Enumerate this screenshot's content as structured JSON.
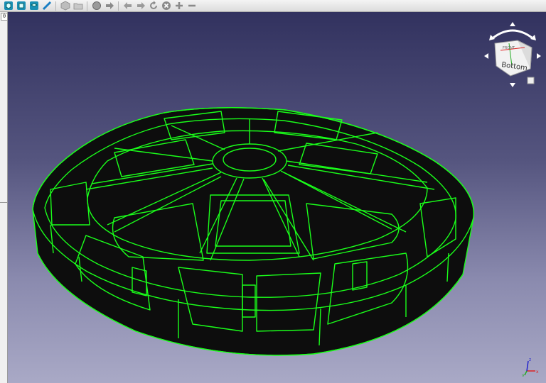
{
  "toolbar": {
    "buttons": [
      {
        "icon": "view-iso-icon"
      },
      {
        "icon": "view-front-icon"
      },
      {
        "icon": "view-top-icon"
      },
      {
        "icon": "measure-icon"
      },
      {
        "icon": "part-icon"
      },
      {
        "icon": "folder-icon"
      },
      {
        "icon": "web-sphere-icon"
      },
      {
        "icon": "forward-arrow-icon"
      },
      {
        "icon": "nav-back-icon"
      },
      {
        "icon": "nav-forward-icon"
      },
      {
        "icon": "refresh-icon"
      },
      {
        "icon": "stop-icon"
      },
      {
        "icon": "zoom-in-icon"
      },
      {
        "icon": "zoom-out-icon"
      }
    ]
  },
  "left_panel": {
    "handle_glyph": "θ"
  },
  "navcube": {
    "face_label": "Bottom",
    "edge_label": "FRONT"
  },
  "axis_indicator": {
    "x_label": "x",
    "y_label": "y",
    "z_label": "z"
  },
  "colors": {
    "edge": "#1aff1a",
    "body": "#0d0d0d",
    "bg_top": "#32325f",
    "bg_bottom": "#a9a9c6"
  }
}
